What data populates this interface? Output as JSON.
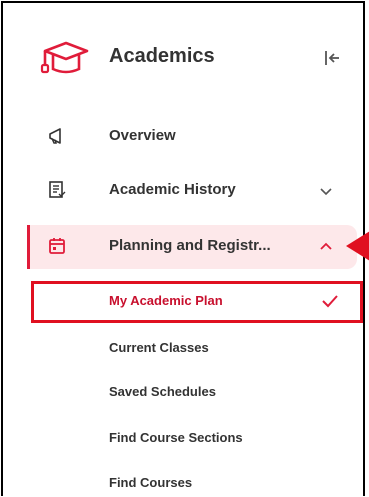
{
  "header": {
    "title": "Academics",
    "icon": "graduation-cap-icon",
    "collapse_icon": "collapse-left-icon"
  },
  "nav": {
    "items": [
      {
        "label": "Overview",
        "icon": "megaphone-icon"
      },
      {
        "label": "Academic History",
        "icon": "document-list-icon",
        "chevron": "chevron-down-icon"
      },
      {
        "label": "Planning and Registr...",
        "icon": "calendar-icon",
        "chevron": "chevron-up-icon",
        "expanded": true
      }
    ],
    "sub_items": [
      {
        "label": "My Academic Plan",
        "selected": true,
        "icon": "check-icon"
      },
      {
        "label": "Current Classes"
      },
      {
        "label": "Saved Schedules"
      },
      {
        "label": "Find Course Sections"
      },
      {
        "label": "Find Courses"
      }
    ]
  },
  "colors": {
    "accent": "#e01c3a",
    "active_bg": "#fde8ea",
    "callout": "#e01020",
    "text": "#333333"
  }
}
